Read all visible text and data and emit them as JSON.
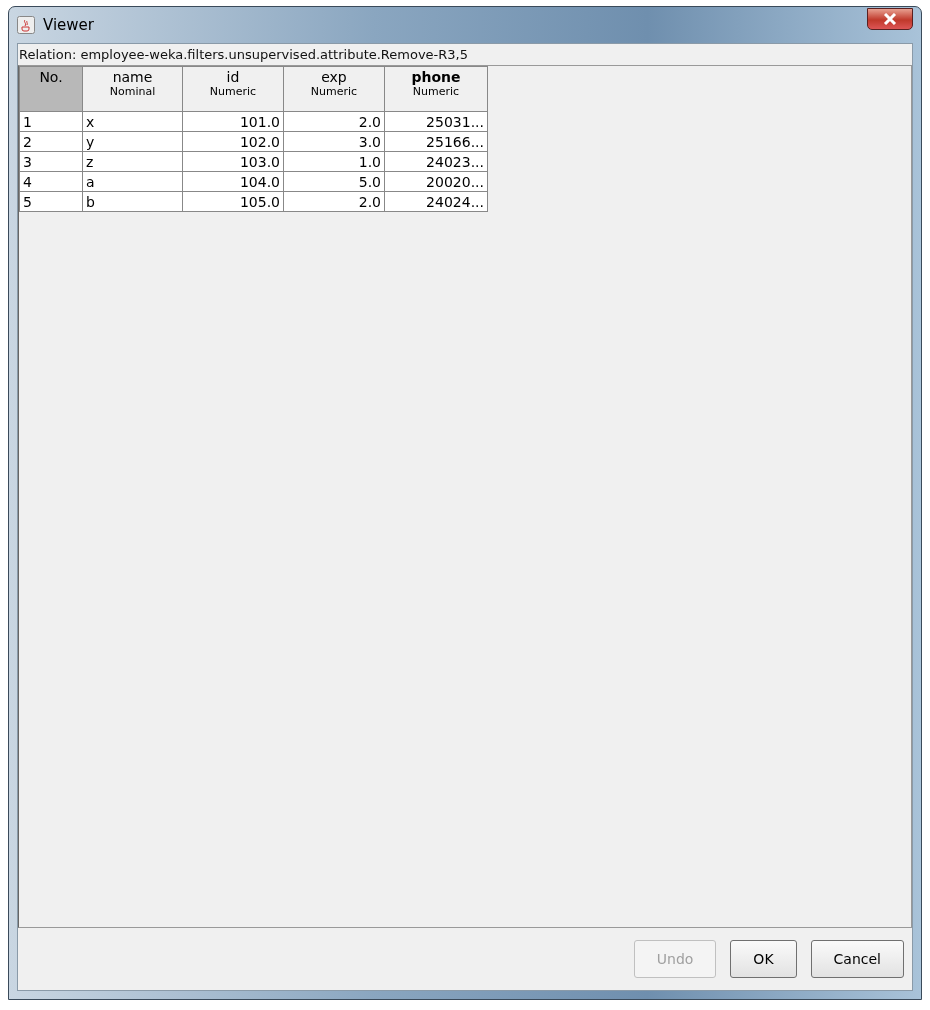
{
  "window": {
    "title": "Viewer"
  },
  "relation": "Relation: employee-weka.filters.unsupervised.attribute.Remove-R3,5",
  "table": {
    "columns": [
      {
        "name": "No.",
        "selected": false,
        "kind": "index"
      },
      {
        "name": "name",
        "type": "Nominal",
        "selected": false,
        "kind": "nominal"
      },
      {
        "name": "id",
        "type": "Numeric",
        "selected": false,
        "kind": "numeric"
      },
      {
        "name": "exp",
        "type": "Numeric",
        "selected": false,
        "kind": "numeric"
      },
      {
        "name": "phone",
        "type": "Numeric",
        "selected": true,
        "kind": "numeric"
      }
    ],
    "rows": [
      [
        "1",
        "x",
        "101.0",
        "2.0",
        "25031..."
      ],
      [
        "2",
        "y",
        "102.0",
        "3.0",
        "25166..."
      ],
      [
        "3",
        "z",
        "103.0",
        "1.0",
        "24023..."
      ],
      [
        "4",
        "a",
        "104.0",
        "5.0",
        "20020..."
      ],
      [
        "5",
        "b",
        "105.0",
        "2.0",
        "24024..."
      ]
    ]
  },
  "buttons": [
    {
      "label": "Undo",
      "disabled": true
    },
    {
      "label": "OK",
      "disabled": false
    },
    {
      "label": "Cancel",
      "disabled": false
    }
  ]
}
